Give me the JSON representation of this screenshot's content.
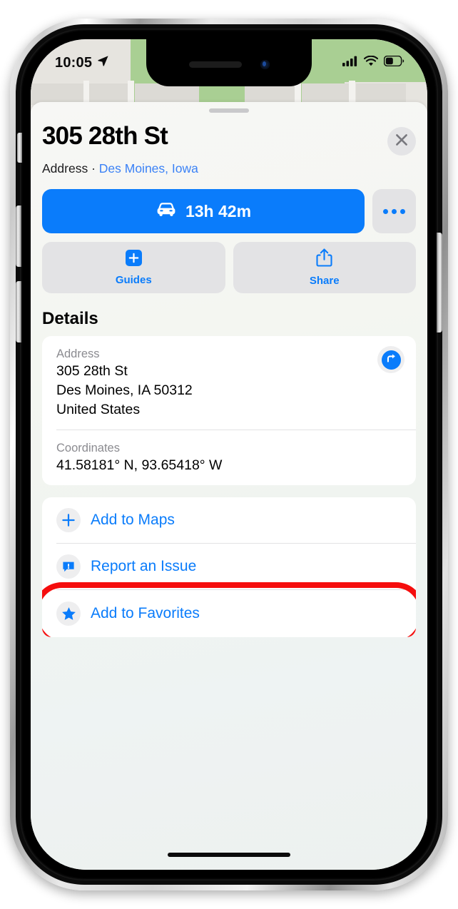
{
  "status_bar": {
    "time": "10:05",
    "location_arrow_icon": "location-arrow-icon",
    "cellular_icon": "cellular-signal-icon",
    "wifi_icon": "wifi-icon",
    "battery_icon": "battery-icon"
  },
  "sheet": {
    "grabber": "sheet-grabber",
    "title": "305 28th St",
    "subtitle_prefix": "Address",
    "subtitle_separator": " · ",
    "subtitle_locality": "Des Moines, Iowa",
    "close_icon": "close-icon"
  },
  "actions": {
    "drive": {
      "icon": "car-icon",
      "label": "13h 42m"
    },
    "more": {
      "icon": "ellipsis-icon"
    },
    "guides": {
      "icon": "plus-square-icon",
      "label": "Guides"
    },
    "share": {
      "icon": "share-icon",
      "label": "Share"
    }
  },
  "details": {
    "heading": "Details",
    "address": {
      "label": "Address",
      "line1": "305 28th St",
      "line2": "Des Moines, IA  50312",
      "line3": "United States",
      "directions_icon": "directions-arrow-icon"
    },
    "coordinates": {
      "label": "Coordinates",
      "value": "41.58181° N, 93.65418° W"
    }
  },
  "action_list": [
    {
      "icon": "plus-icon",
      "label": "Add to Maps",
      "highlighted": false
    },
    {
      "icon": "report-icon",
      "label": "Report an Issue",
      "highlighted": false
    },
    {
      "icon": "star-icon",
      "label": "Add to Favorites",
      "highlighted": true
    }
  ],
  "colors": {
    "accent_blue": "#0a7cfb",
    "link_blue": "#3b82f6",
    "highlight_red": "#f50d0d",
    "card_white": "#ffffff",
    "chip_gray": "#e3e3e5"
  },
  "home_indicator": "home-indicator"
}
